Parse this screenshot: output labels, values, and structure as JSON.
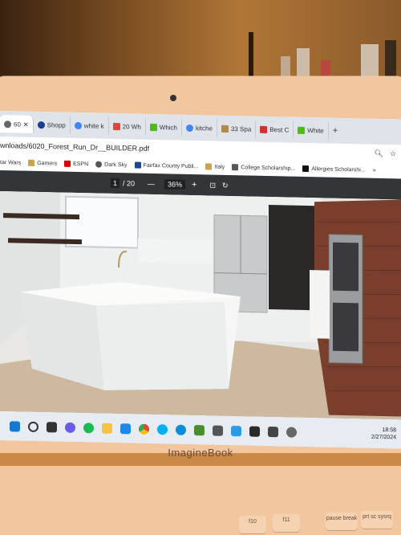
{
  "browser": {
    "tabs": [
      {
        "label": "60",
        "active": true
      },
      {
        "label": "Shopp"
      },
      {
        "label": "white k"
      },
      {
        "label": "20 Wh"
      },
      {
        "label": "Which"
      },
      {
        "label": "kitche"
      },
      {
        "label": "33 Spa"
      },
      {
        "label": "Best C"
      },
      {
        "label": "White"
      }
    ],
    "new_tab": "+",
    "url": "wnloads/6020_Forest_Run_Dr__BUILDER.pdf",
    "bookmarks": [
      "tar Wars",
      "Gamers",
      "ESPN",
      "Dark Sky",
      "Fairfax County Publi...",
      "Italy",
      "College Scholarship...",
      "Allergies Scholarshi...",
      "»"
    ]
  },
  "pdf_toolbar": {
    "page_current": "1",
    "page_total": "/ 20",
    "zoom_minus": "—",
    "zoom": "36%",
    "zoom_plus": "+"
  },
  "taskbar": {
    "time": "18:58",
    "date": "2/27/2024"
  },
  "laptop": {
    "brand": "ImagineBook",
    "keys": [
      "f10",
      "f11",
      "pause break",
      "prt sc sysrq"
    ]
  }
}
